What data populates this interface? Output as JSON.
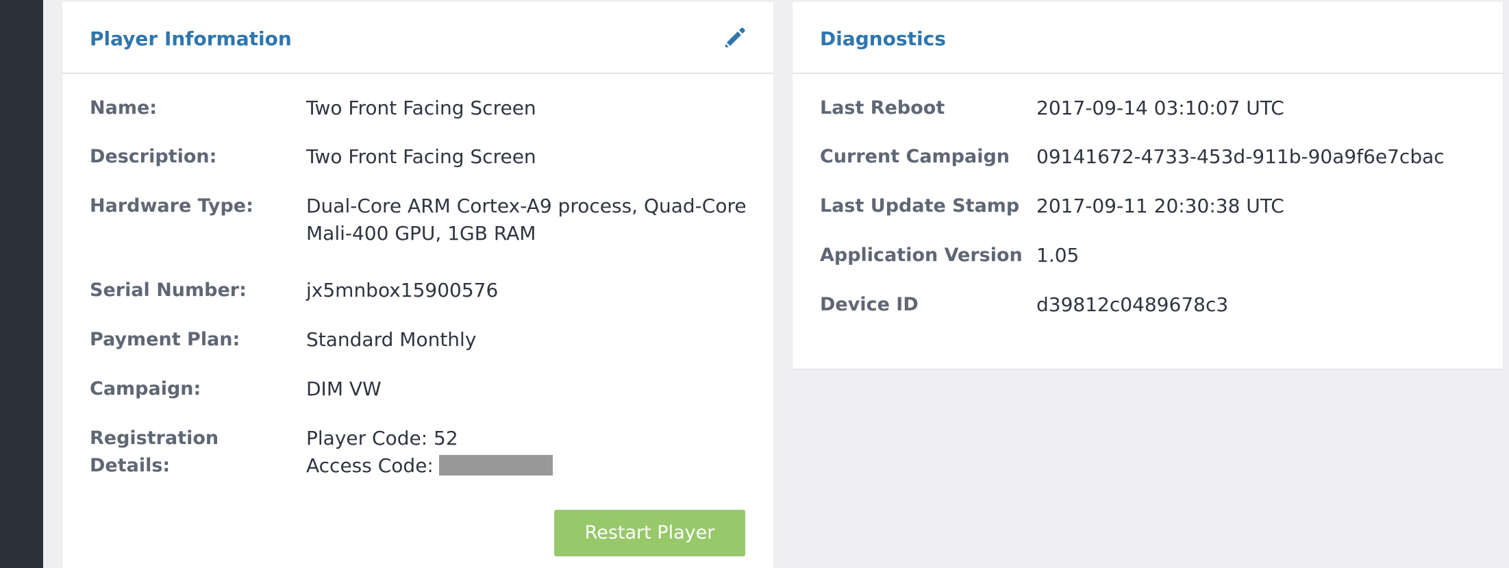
{
  "player_info": {
    "title": "Player Information",
    "edit_icon": "pencil-icon",
    "rows": [
      {
        "label": "Name:",
        "value": "Two Front Facing Screen"
      },
      {
        "label": "Description:",
        "value": "Two Front Facing Screen"
      },
      {
        "label": "Hardware Type:",
        "value_line1": "Dual-Core ARM Cortex-A9 process, Quad-Core",
        "value_line2": "Mali-400 GPU, 1GB RAM"
      },
      {
        "label": "Serial Number:",
        "value": "jx5mnbox15900576"
      },
      {
        "label": "Payment Plan:",
        "value": "Standard Monthly"
      },
      {
        "label": "Campaign:",
        "value": "DIM VW"
      },
      {
        "label": "Registration Details:",
        "player_code": "Player Code: 52",
        "access_code_label": "Access Code:"
      }
    ],
    "restart_button": "Restart Player"
  },
  "diagnostics": {
    "title": "Diagnostics",
    "rows": [
      {
        "label": "Last Reboot",
        "value": "2017-09-14 03:10:07 UTC"
      },
      {
        "label": "Current Campaign",
        "value": "09141672-4733-453d-911b-90a9f6e7cbac"
      },
      {
        "label": "Last Update Stamp",
        "value": "2017-09-11 20:30:38 UTC"
      },
      {
        "label": "Application Version",
        "value": "1.05"
      },
      {
        "label": "Device ID",
        "value": "d39812c0489678c3"
      }
    ]
  },
  "colors": {
    "sidebar": "#2c323a",
    "title": "#2f76ad",
    "button": "#97c86a",
    "background": "#efeef1"
  }
}
